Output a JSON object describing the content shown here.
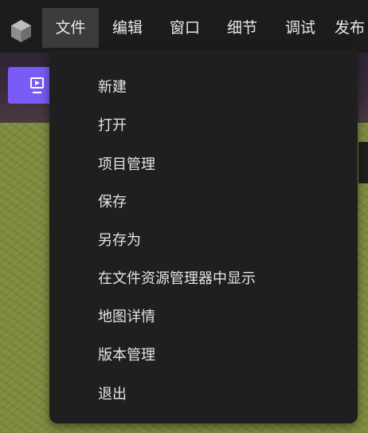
{
  "menubar": {
    "logo_icon": "cube-logo-icon",
    "items": [
      {
        "label": "文件",
        "active": true
      },
      {
        "label": "编辑"
      },
      {
        "label": "窗口"
      },
      {
        "label": "细节"
      },
      {
        "label": "调试"
      },
      {
        "label": "发布"
      }
    ]
  },
  "toolbar": {
    "play_icon": "play-preview-icon",
    "accent_color": "#7b5bf5"
  },
  "file_menu": {
    "items": [
      {
        "label": "新建"
      },
      {
        "label": "打开"
      },
      {
        "label": "项目管理"
      },
      {
        "label": "保存"
      },
      {
        "label": "另存为"
      },
      {
        "label": "在文件资源管理器中显示"
      },
      {
        "label": "地图详情"
      },
      {
        "label": "版本管理"
      },
      {
        "label": "退出"
      }
    ]
  },
  "colors": {
    "menubar_bg": "#1c1c1c",
    "menu_active_bg": "#3c3c3c",
    "dropdown_bg": "#1f1f1f",
    "terrain": "#7e8c3f"
  }
}
